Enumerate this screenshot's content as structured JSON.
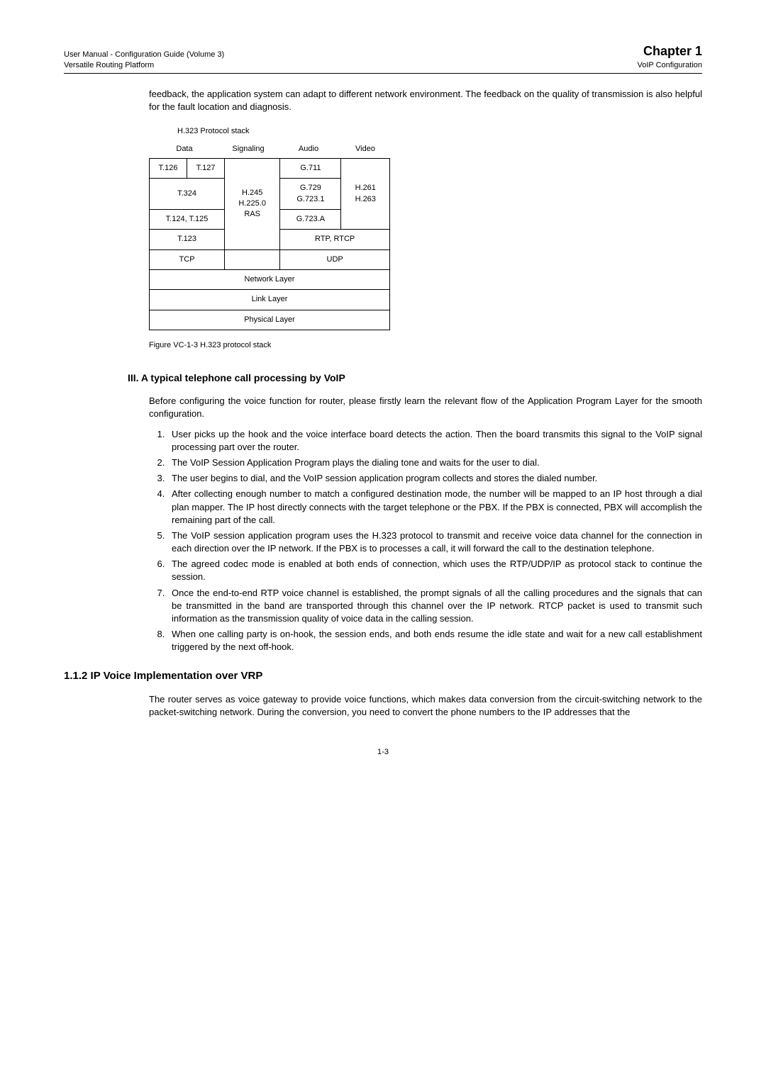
{
  "header": {
    "left1": "User Manual - Configuration Guide (Volume 3)",
    "left2": "Versatile Routing Platform",
    "chapter": "Chapter 1",
    "sub": "VoIP Configuration"
  },
  "intro_para": "feedback, the application system can adapt to different network environment. The feedback on the quality of transmission is also helpful for the fault location and diagnosis.",
  "fig_top_caption": "H.323 Protocol stack",
  "labels": {
    "data": "Data",
    "signaling": "Signaling",
    "audio": "Audio",
    "video": "Video"
  },
  "stack": {
    "t126": "T.126",
    "t127": "T.127",
    "sig": "H.245\nH.225.0\nRAS",
    "g711": "G.711",
    "t324": "T.324",
    "g729_7231": "G.729\nG.723.1",
    "h261_263": "H.261\nH.263",
    "t124_125": "T.124, T.125",
    "g723a": "G.723.A",
    "t123": "T.123",
    "rtp": "RTP, RTCP",
    "tcp": "TCP",
    "udp": "UDP",
    "net": "Network Layer",
    "link": "Link Layer",
    "phys": "Physical Layer"
  },
  "fig_bottom_caption": "Figure VC-1-3  H.323 protocol stack",
  "subhead3": "III. A typical telephone call processing by VoIP",
  "para_before_list": "Before configuring the voice function for router, please firstly learn the relevant flow of the Application Program Layer for the smooth configuration.",
  "list": [
    "User picks up the hook and the voice interface board detects the action. Then the board transmits this signal to the VoIP signal processing part over the router.",
    "The VoIP Session Application Program plays the dialing tone and waits for the user to dial.",
    "The user begins to dial, and the VoIP session application program collects and stores the dialed number.",
    "After collecting enough number to match a configured destination mode, the number will be mapped to an IP host through a dial plan mapper. The IP host directly connects with the target telephone or the PBX. If the PBX is connected, PBX will accomplish the remaining part of the call.",
    "The VoIP session application program uses the H.323 protocol to transmit and receive voice data channel for the connection in each direction over the IP network. If the PBX is to processes a call, it will forward the call to the destination telephone.",
    "The agreed codec mode is enabled at both ends of connection, which uses the RTP/UDP/IP as protocol stack to continue the session.",
    "Once the end-to-end RTP voice channel is established, the prompt signals of all the calling procedures and the signals that can be transmitted in the band are transported through this channel over the IP network. RTCP packet is used to transmit such information as the transmission quality of voice data in the calling session.",
    "When one calling party is on-hook, the session ends, and both ends resume the idle state and wait for a new call establishment triggered by the next off-hook."
  ],
  "sec_heading": "1.1.2  IP Voice Implementation over VRP",
  "sec_para": "The router serves as voice gateway to provide voice functions, which makes data conversion from the circuit-switching network to the packet-switching network. During the conversion, you need to convert the phone numbers to the IP addresses that the",
  "page_number": "1-3"
}
